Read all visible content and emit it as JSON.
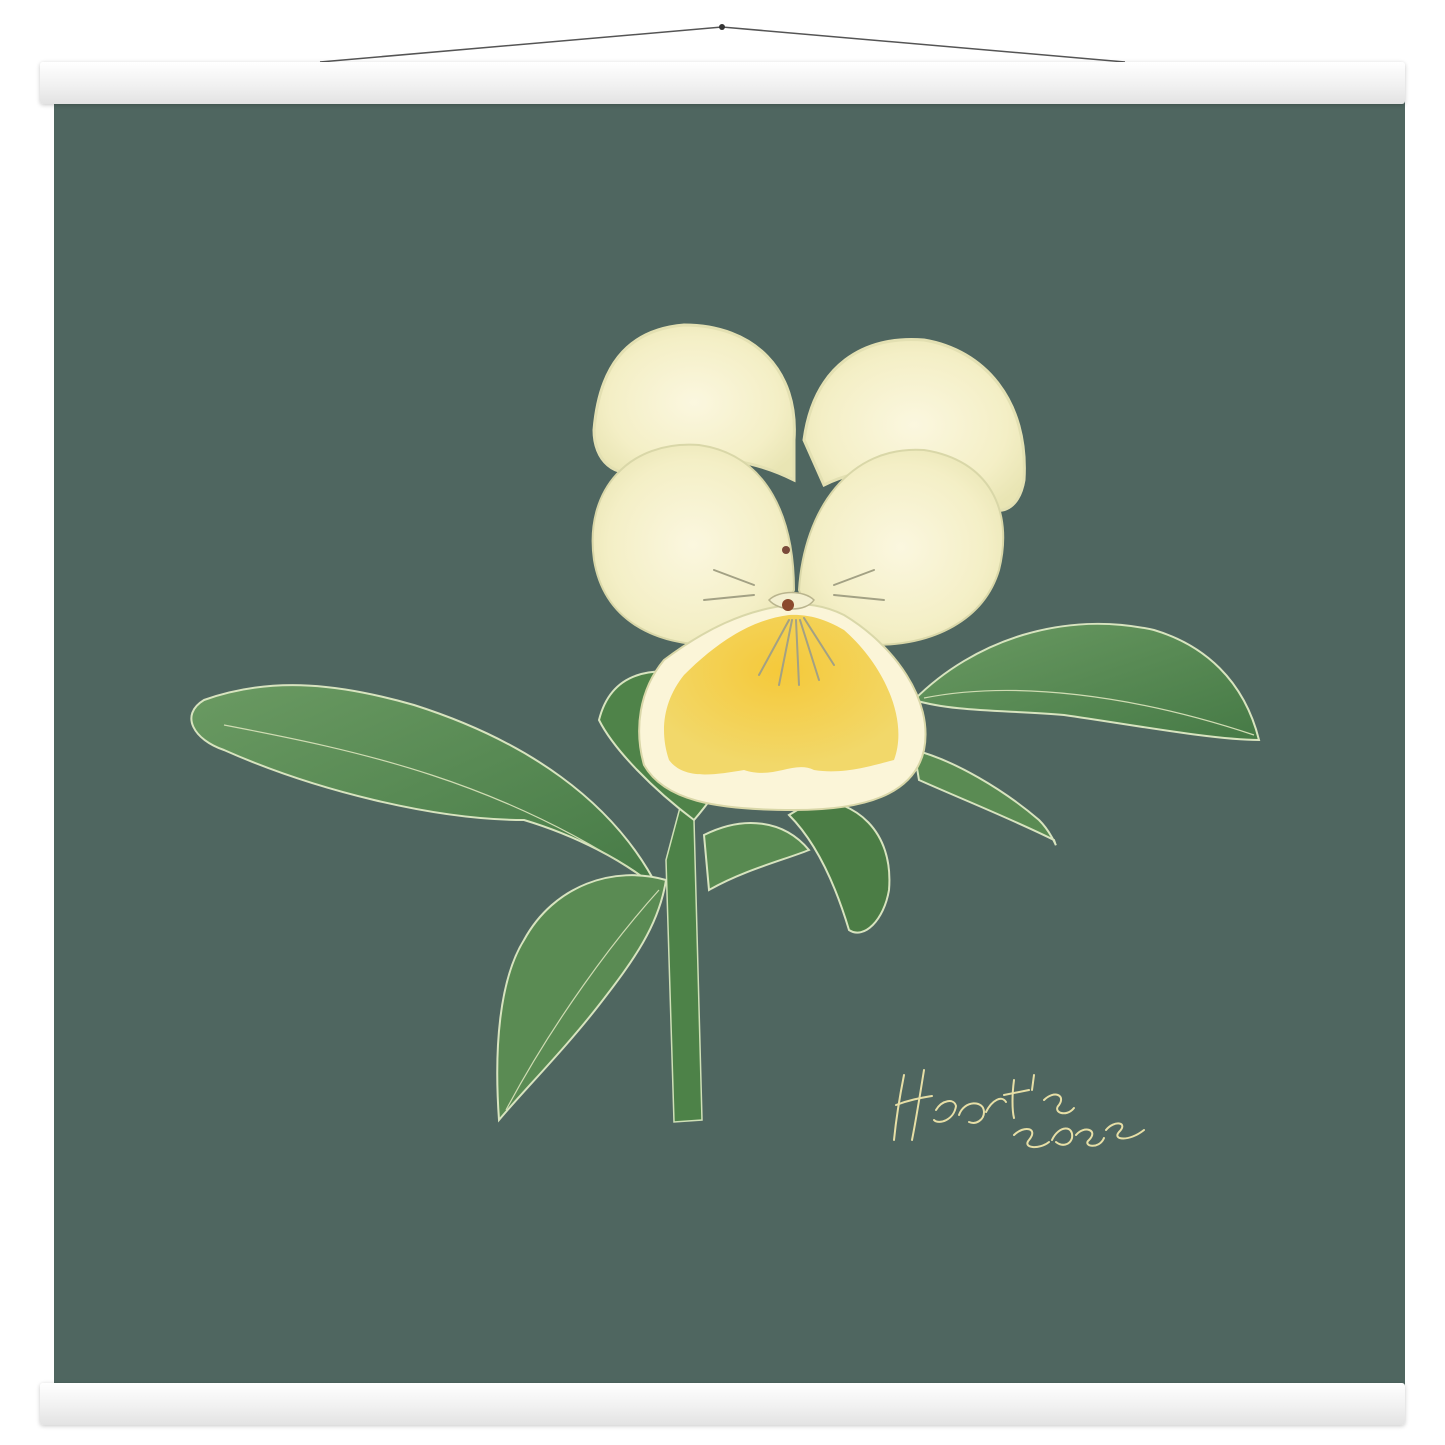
{
  "artwork": {
    "caption_line1": "Heart's",
    "caption_line2": "ease",
    "colors": {
      "background": "#4f6660",
      "leaf": "#5e8d57",
      "leaf_dark": "#3f6d3f",
      "petal_cream": "#f7f2cf",
      "petal_yellow": "#f3cd46",
      "signature": "#e7dfa6"
    }
  }
}
